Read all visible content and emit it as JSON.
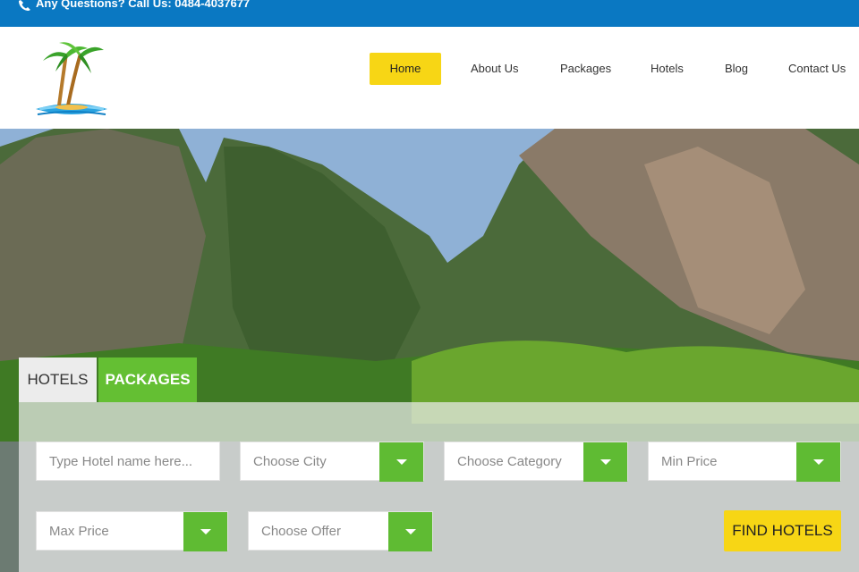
{
  "topbar": {
    "contact_text": "Any Questions? Call Us: 0484-4037677"
  },
  "nav": {
    "items": [
      "Home",
      "About Us",
      "Packages",
      "Hotels",
      "Blog",
      "Contact Us"
    ],
    "active": "Home"
  },
  "search": {
    "tabs": [
      "HOTELS",
      "PACKAGES"
    ],
    "hotel_name_placeholder": "Type Hotel name here...",
    "city": "Choose City",
    "category": "Choose Category",
    "min_price": "Min Price",
    "max_price": "Max Price",
    "offer": "Choose Offer",
    "find_button": "FIND HOTELS"
  },
  "colors": {
    "topbar": "#0a78c2",
    "accent_yellow": "#f7d615",
    "accent_green": "#64bf33"
  }
}
